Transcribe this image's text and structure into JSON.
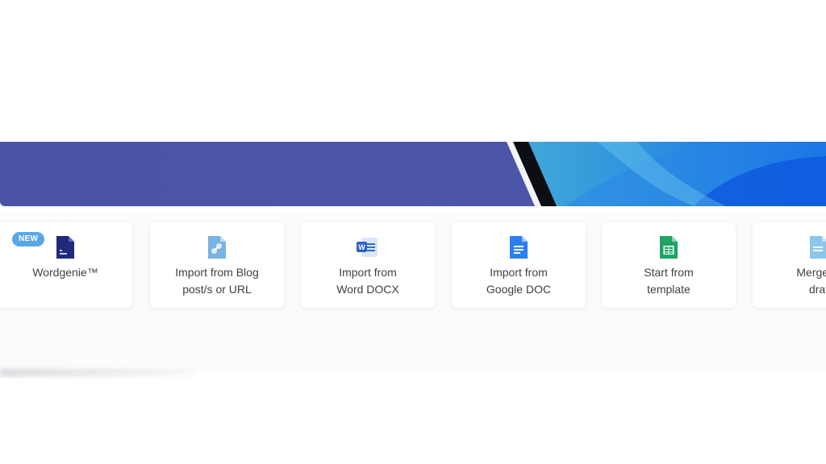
{
  "banner": {
    "left_color": "#4b55a6",
    "right_color": "#1a73e8"
  },
  "badge": {
    "text": "NEW",
    "color": "#5aa6e6"
  },
  "accent": {
    "marker_color": "#f0367a"
  },
  "cards": [
    {
      "label": "Wordgenie™",
      "icon": "wordgenie-doc-icon"
    },
    {
      "label": "Import from Blog\npost/s or URL",
      "icon": "link-doc-icon"
    },
    {
      "label": "Import from\nWord DOCX",
      "icon": "word-docx-icon"
    },
    {
      "label": "Import from\nGoogle DOC",
      "icon": "google-doc-icon"
    },
    {
      "label": "Start from\ntemplate",
      "icon": "google-sheets-template-icon"
    },
    {
      "label": "Merge m\ndraf",
      "icon": "merge-drafts-icon"
    }
  ]
}
